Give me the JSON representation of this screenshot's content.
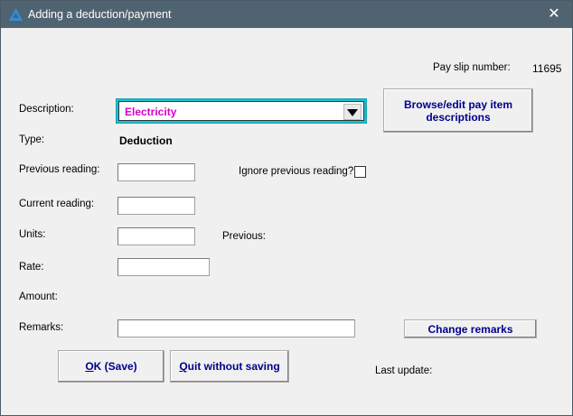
{
  "window": {
    "title": "Adding a deduction/payment",
    "close_label": "✕"
  },
  "payslip": {
    "label": "Pay slip number:",
    "value": "11695"
  },
  "description": {
    "label": "Description:",
    "selected": "Electricity"
  },
  "browse_button": {
    "line1": "Browse/edit pay item",
    "line2": "descriptions"
  },
  "type": {
    "label": "Type:",
    "value": "Deduction"
  },
  "previous_reading": {
    "label": "Previous reading:",
    "value": ""
  },
  "ignore_previous": {
    "label": "Ignore previous reading?",
    "checked": false
  },
  "current_reading": {
    "label": "Current reading:",
    "value": ""
  },
  "units": {
    "label": "Units:",
    "value": "",
    "previous_label": "Previous:"
  },
  "rate": {
    "label": "Rate:",
    "value": ""
  },
  "amount": {
    "label": "Amount:"
  },
  "remarks": {
    "label": "Remarks:",
    "value": "",
    "change_button": "Change remarks"
  },
  "buttons": {
    "ok_accel": "O",
    "ok_rest": "K (Save)",
    "quit_accel": "Q",
    "quit_rest": "uit without saving"
  },
  "last_update": {
    "label": "Last update:"
  },
  "colors": {
    "titlebar": "#506370",
    "accent_text": "#d600c8",
    "button_text": "#00008b",
    "combo_border": "#15c2d0"
  },
  "icons": {
    "app": "triangle-logo-icon",
    "close": "close-icon",
    "dropdown": "dropdown-arrow-icon"
  }
}
